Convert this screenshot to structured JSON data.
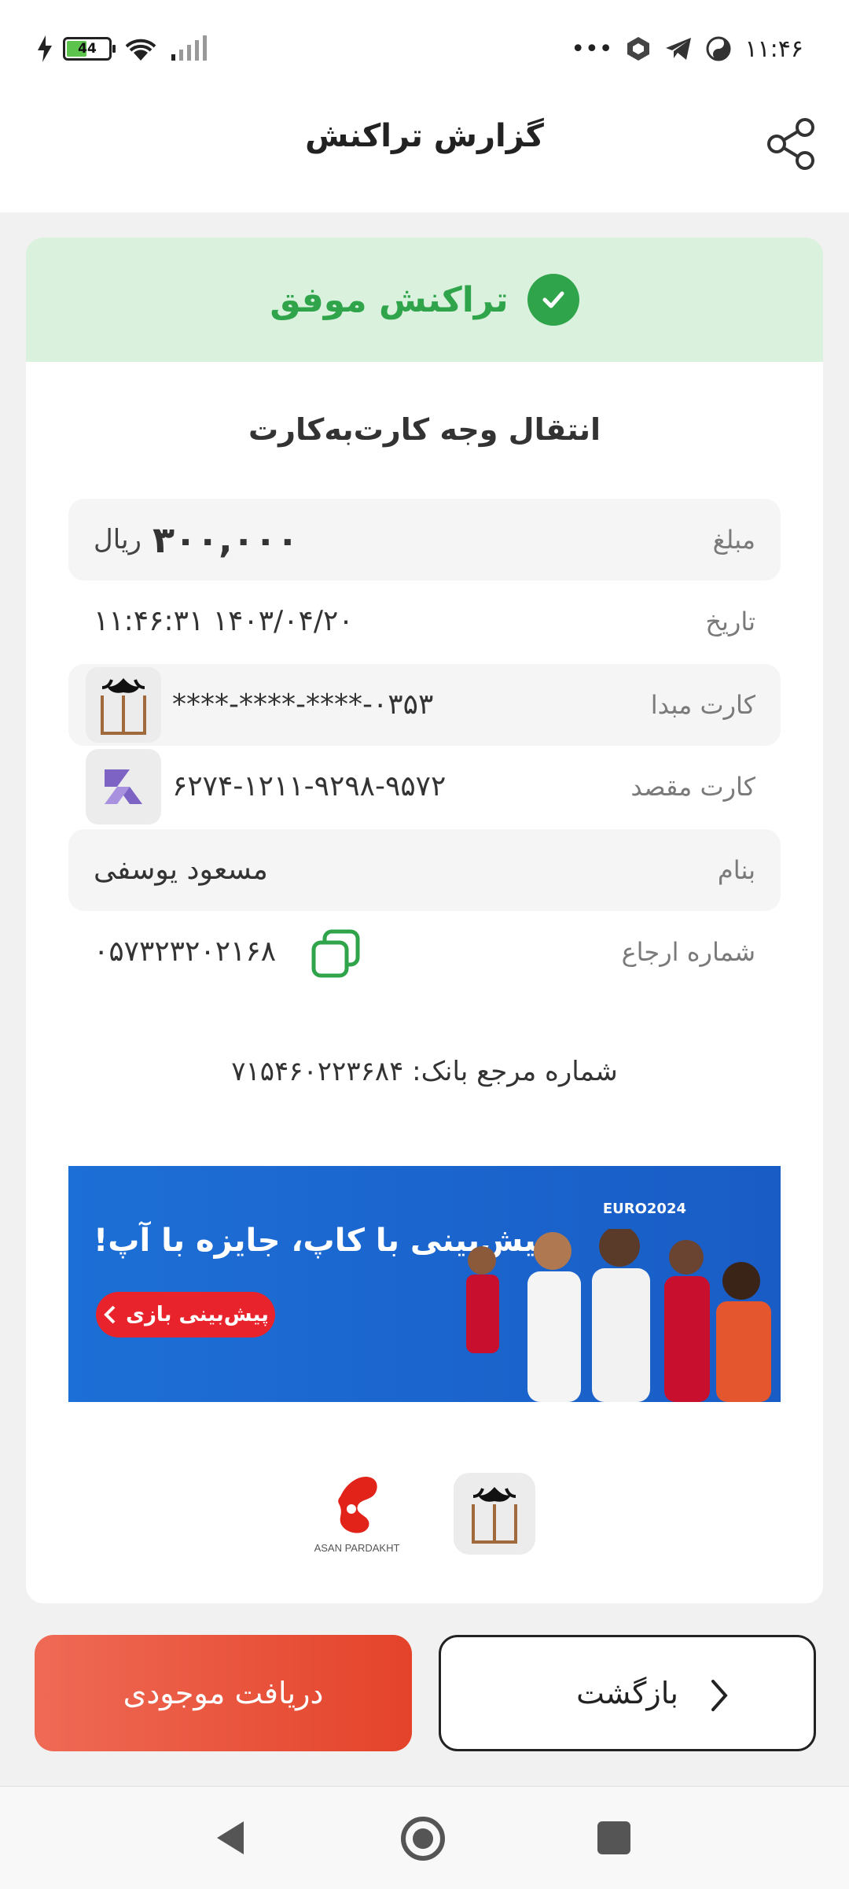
{
  "status_bar": {
    "time": "۱۱:۴۶",
    "battery": "44",
    "more": "•••"
  },
  "header": {
    "title": "گزارش تراکنش"
  },
  "status": {
    "text": "تراکنش موفق"
  },
  "transaction_title": "انتقال وجه کارت‌به‌کارت",
  "details": {
    "amount_label": "مبلغ",
    "amount_value": "۳۰۰,۰۰۰",
    "amount_unit": "ریال",
    "date_label": "تاریخ",
    "date_value": "۱۱:۴۶:۳۱ ۱۴۰۳/۰۴/۲۰",
    "source_card_label": "کارت مبدا",
    "source_card_value": "****-****-****-۰۳۵۳",
    "dest_card_label": "کارت مقصد",
    "dest_card_value": "۶۲۷۴-۱۲۱۱-۹۲۹۸-۹۵۷۲",
    "name_label": "بنام",
    "name_value": "مسعود یوسفی",
    "ref_label": "شماره ارجاع",
    "ref_value": "۰۵۷۳۲۳۲۰۲۱۶۸"
  },
  "bank_reference": "شماره مرجع بانک: ۷۱۵۴۶۰۲۲۳۶۸۴",
  "banner": {
    "headline": "پیش‌بینی با کاپ، جایزه با آپ!",
    "button": "پیش‌بینی بازی",
    "badge": "EURO2024"
  },
  "footer_logos": {
    "asan_text": "ASAN PARDAKHT"
  },
  "buttons": {
    "balance": "دریافت موجودی",
    "back": "بازگشت"
  },
  "colors": {
    "success": "#2fa44a",
    "success_bg": "#d9f1dd",
    "primary_button": "#e4432a",
    "banner": "#1a5cc6"
  }
}
